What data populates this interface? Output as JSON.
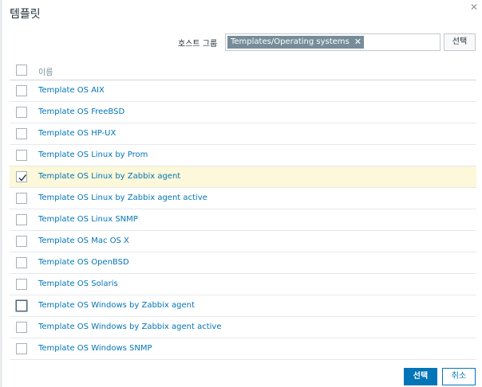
{
  "dialog": {
    "title": "템플릿",
    "close_icon": "close-icon"
  },
  "filter": {
    "label": "호스트 그룹",
    "chip_label": "Templates/Operating systems",
    "chip_remove_icon": "x-icon",
    "select_label": "선택"
  },
  "table": {
    "name_header": "이름",
    "rows": [
      {
        "name": "Template OS AIX",
        "checked": false
      },
      {
        "name": "Template OS FreeBSD",
        "checked": false
      },
      {
        "name": "Template OS HP-UX",
        "checked": false
      },
      {
        "name": "Template OS Linux by Prom",
        "checked": false
      },
      {
        "name": "Template OS Linux by Zabbix agent",
        "checked": true
      },
      {
        "name": "Template OS Linux by Zabbix agent active",
        "checked": false
      },
      {
        "name": "Template OS Linux SNMP",
        "checked": false
      },
      {
        "name": "Template OS Mac OS X",
        "checked": false
      },
      {
        "name": "Template OS OpenBSD",
        "checked": false
      },
      {
        "name": "Template OS Solaris",
        "checked": false
      },
      {
        "name": "Template OS Windows by Zabbix agent",
        "checked": false
      },
      {
        "name": "Template OS Windows by Zabbix agent active",
        "checked": false
      },
      {
        "name": "Template OS Windows SNMP",
        "checked": false
      }
    ]
  },
  "footer": {
    "select_label": "선택",
    "cancel_label": "취소"
  },
  "colors": {
    "link": "#0275b8",
    "selected_row": "#fcf8d9",
    "chip": "#768d99",
    "primary": "#0275b8"
  }
}
